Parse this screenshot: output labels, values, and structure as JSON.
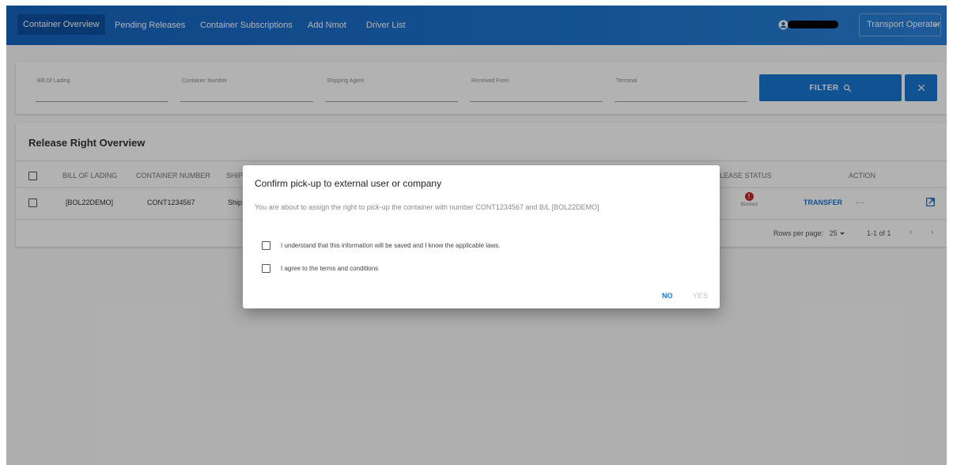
{
  "nav": {
    "items": [
      {
        "label": "Container Overview",
        "active": true
      },
      {
        "label": "Pending Releases"
      },
      {
        "label": "Container Subscriptions"
      },
      {
        "label": "Add Nmot"
      },
      {
        "label": "Driver List"
      }
    ],
    "user_icon": "account-circle-icon",
    "role": "Transport Operator"
  },
  "filters": {
    "fields": [
      {
        "label": "Bill Of Lading"
      },
      {
        "label": "Container Number"
      },
      {
        "label": "Shipping Agent"
      },
      {
        "label": "Received From"
      },
      {
        "label": "Terminal"
      }
    ],
    "filter_button": "FILTER",
    "filter_icon": "search-icon",
    "clear_icon": "close-icon"
  },
  "table": {
    "title": "Release Right Overview",
    "columns": [
      "BILL OF LADING",
      "CONTAINER NUMBER",
      "SHIP",
      "LEASE STATUS",
      "ACTION"
    ],
    "rows": [
      {
        "bill_of_lading": "[BOL22DEMO]",
        "container_number": "CONT1234567",
        "shipping_agent": "Ship",
        "status": "Blocked",
        "status_icon": "error-icon",
        "action": "TRANSFER",
        "more": "...",
        "open_icon": "open-in-new-icon"
      }
    ],
    "pagination": {
      "rows_per_page_label": "Rows per page:",
      "rows_per_page": "25",
      "range": "1-1 of 1"
    }
  },
  "dialog": {
    "title": "Confirm pick-up to external user or company",
    "message": "You are about to assign the right to pick-up the container with number CONT1234567 and B/L [BOL22DEMO]",
    "checkboxes": [
      {
        "label": "I understand that this information will be saved and I know the applicable laws.",
        "checked": false
      },
      {
        "label": "I agree to the terms and conditions",
        "checked": false
      }
    ],
    "no_label": "NO",
    "yes_label": "YES"
  },
  "colors": {
    "primary": "#1976d2",
    "nav_gradient_start": "#1565c0",
    "blocked": "#c62828",
    "overlay": "rgba(0,0,0,0.30)"
  }
}
